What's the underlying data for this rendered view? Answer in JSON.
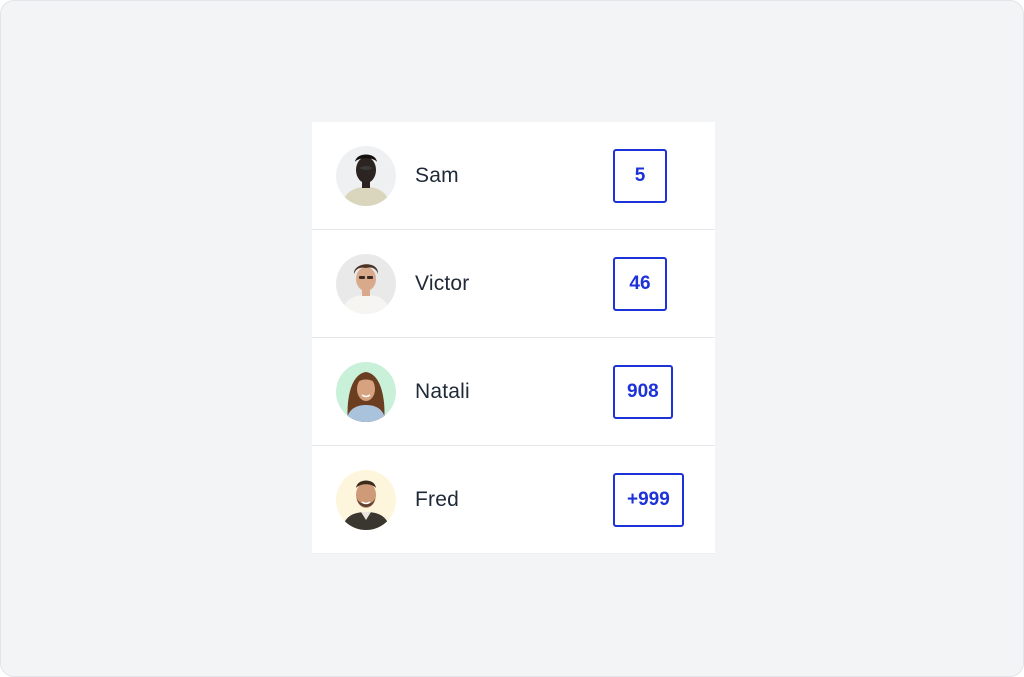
{
  "colors": {
    "badge_accent": "#1d32d8",
    "page_background": "#f3f4f6",
    "card_background": "#ffffff"
  },
  "users": [
    {
      "name": "Sam",
      "count": "5",
      "avatar_icon": "avatar-sam"
    },
    {
      "name": "Victor",
      "count": "46",
      "avatar_icon": "avatar-victor"
    },
    {
      "name": "Natali",
      "count": "908",
      "avatar_icon": "avatar-natali"
    },
    {
      "name": "Fred",
      "count": "+999",
      "avatar_icon": "avatar-fred"
    }
  ]
}
